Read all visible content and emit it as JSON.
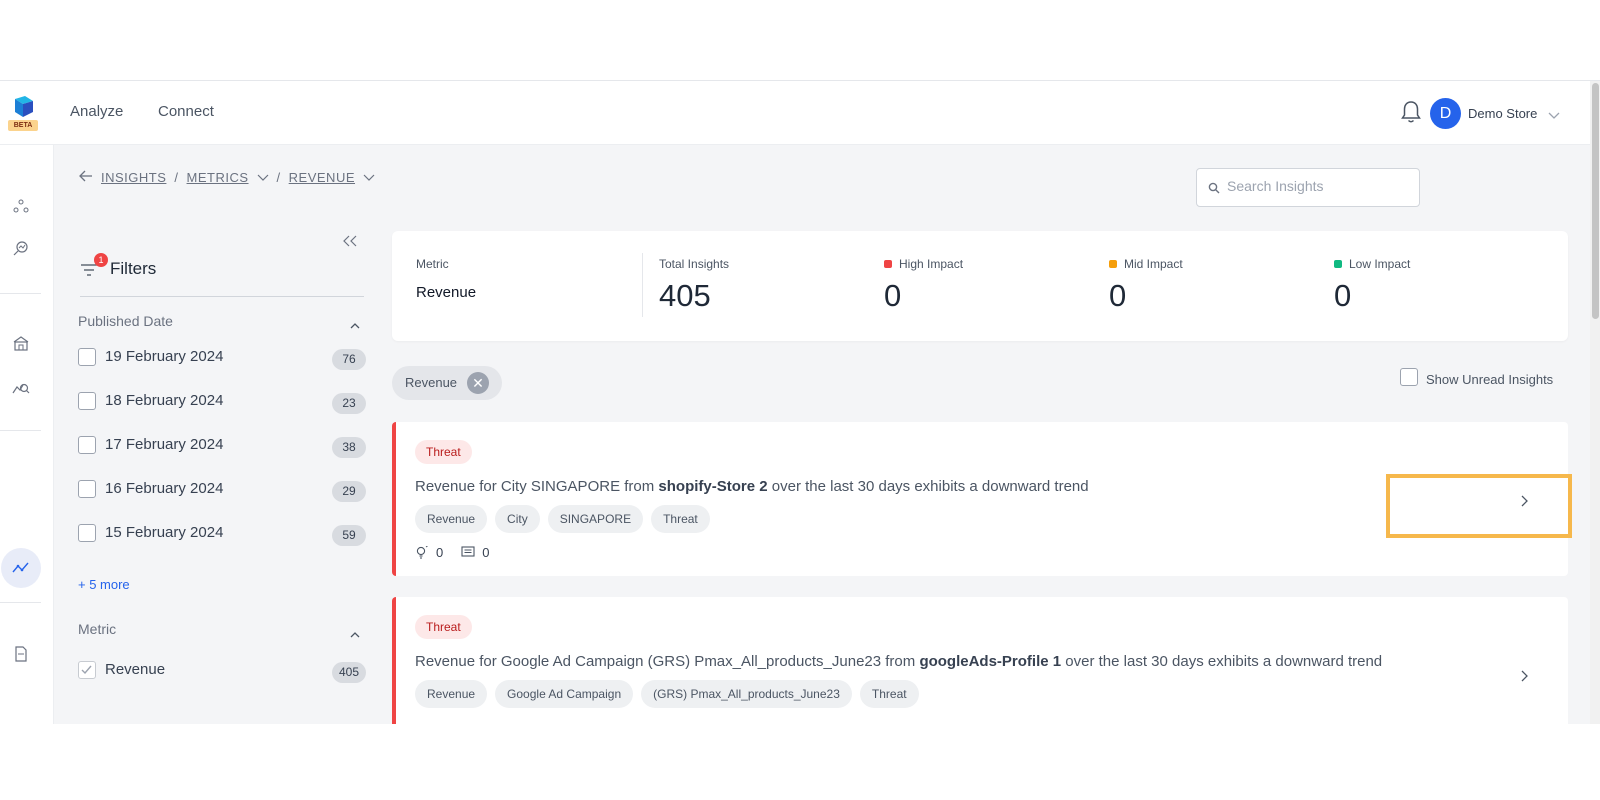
{
  "app": {
    "beta_label": "BETA"
  },
  "nav": {
    "analyze": "Analyze",
    "connect": "Connect"
  },
  "user": {
    "avatar_initial": "D",
    "store_name": "Demo Store"
  },
  "breadcrumb": {
    "insights": "INSIGHTS",
    "sep1": "/",
    "metrics": "METRICS",
    "sep2": "/",
    "revenue": "REVENUE"
  },
  "search": {
    "placeholder": "Search Insights"
  },
  "filters": {
    "title": "Filters",
    "badge_count": "1",
    "published_date": {
      "title": "Published Date",
      "items": [
        {
          "label": "19 February 2024",
          "count": "76"
        },
        {
          "label": "18 February 2024",
          "count": "23"
        },
        {
          "label": "17 February 2024",
          "count": "38"
        },
        {
          "label": "16 February 2024",
          "count": "29"
        },
        {
          "label": "15 February 2024",
          "count": "59"
        }
      ],
      "more": "+ 5 more"
    },
    "metric": {
      "title": "Metric",
      "items": [
        {
          "label": "Revenue",
          "count": "405",
          "checked": true
        }
      ]
    }
  },
  "summary": {
    "metric_label": "Metric",
    "metric_value": "Revenue",
    "total_label": "Total Insights",
    "total_value": "405",
    "high_label": "High Impact",
    "high_value": "0",
    "high_color": "#ef4444",
    "mid_label": "Mid Impact",
    "mid_value": "0",
    "mid_color": "#f59e0b",
    "low_label": "Low Impact",
    "low_value": "0",
    "low_color": "#10b981"
  },
  "active_filter_chip": "Revenue",
  "show_unread": "Show Unread Insights",
  "insights": [
    {
      "badge": "Threat",
      "title_pre": "Revenue for City SINGAPORE from ",
      "title_bold": "shopify-Store 2",
      "title_post": " over the last 30 days exhibits a downward trend",
      "tags": [
        "Revenue",
        "City",
        "SINGAPORE",
        "Threat"
      ],
      "likes": "0",
      "comments": "0"
    },
    {
      "badge": "Threat",
      "title_pre": "Revenue for Google Ad Campaign (GRS) Pmax_All_products_June23 from ",
      "title_bold": "googleAds-Profile 1",
      "title_post": " over the last 30 days exhibits a downward trend",
      "tags": [
        "Revenue",
        "Google Ad Campaign",
        "(GRS) Pmax_All_products_June23",
        "Threat"
      ]
    }
  ],
  "colors": {
    "accent": "#2563eb",
    "threat": "#ef4444",
    "highlight": "#f6b84c"
  }
}
